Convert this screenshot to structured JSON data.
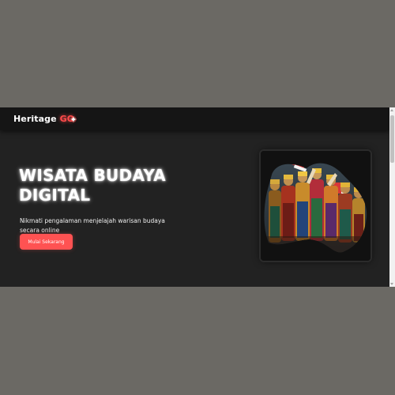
{
  "navbar": {
    "brand_main": "Heritage ",
    "brand_accent": "GO",
    "brand_icon": "spark-icon"
  },
  "hero": {
    "title": "WISATA BUDAYA DIGITAL",
    "subtitle": "Nikmati pengalaman menjelajah warisan budaya secara online",
    "cta_label": "Mulai Sekarang",
    "image_subject": "traditional-dancers-photo"
  },
  "colors": {
    "page_backdrop": "#6b6964",
    "hero_bg": "#222222",
    "navbar_bg": "#151515",
    "accent": "#ff4b4b",
    "button": "#ff5252",
    "text": "#ffffff"
  }
}
